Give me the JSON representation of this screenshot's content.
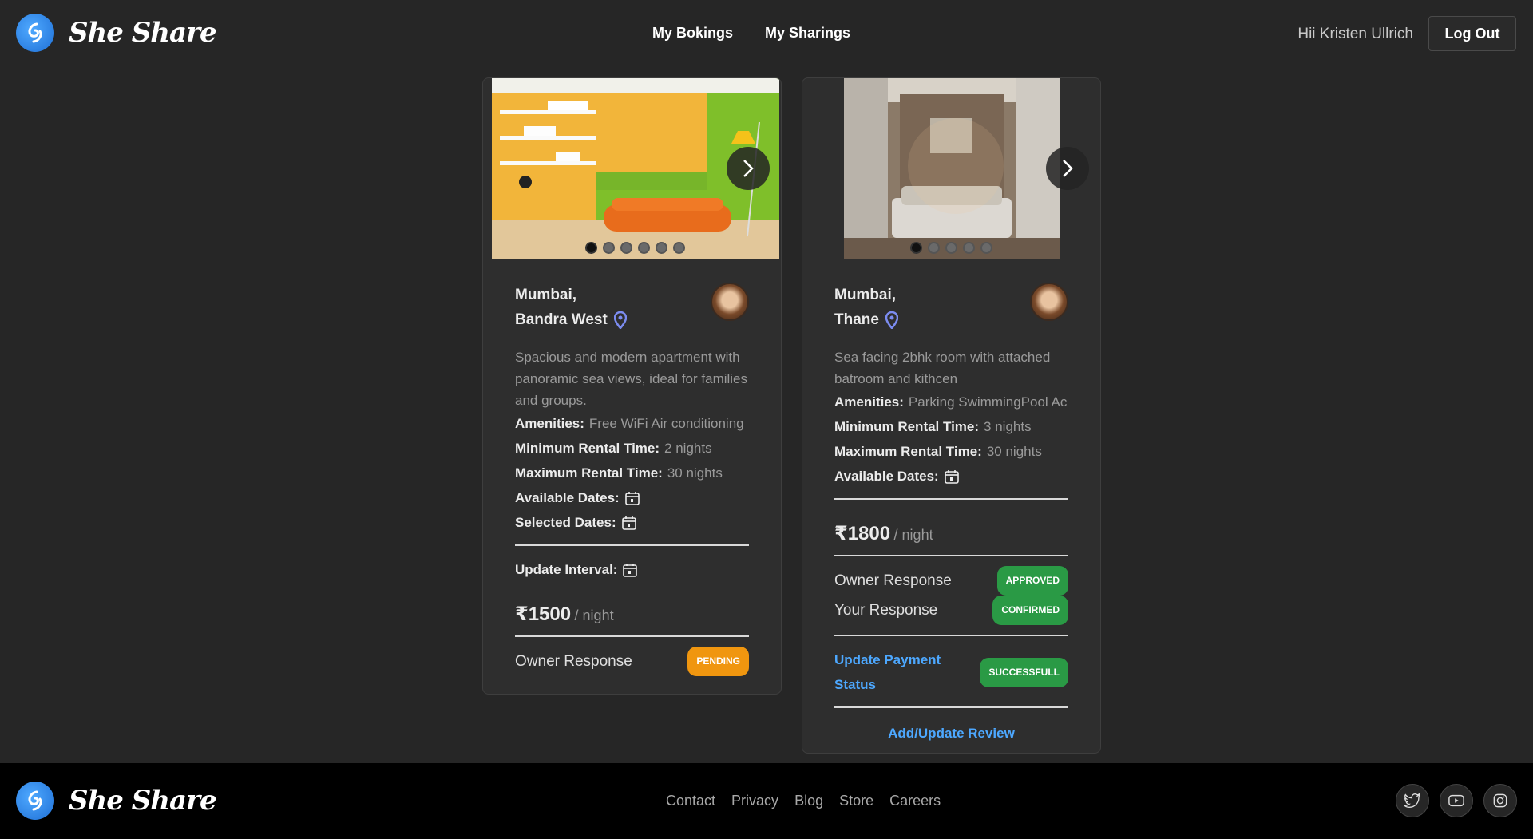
{
  "brand": {
    "name": "She Share",
    "logo_icon": "she-share-logo-icon",
    "accent": "#2f8df2"
  },
  "nav": {
    "bookings": "My Bokings",
    "sharings": "My Sharings"
  },
  "user": {
    "greeting": "Hii Kristen Ullrich",
    "logout": "Log Out"
  },
  "cards": [
    {
      "city": "Mumbai,",
      "area": "Bandra West",
      "description": "Spacious and modern apartment with panoramic sea views, ideal for families and groups.",
      "amenities_label": "Amenities:",
      "amenities": "Free WiFi Air conditioning",
      "min_label": "Minimum Rental Time:",
      "min_value": "2 nights",
      "max_label": "Maximum Rental Time:",
      "max_value": "30 nights",
      "available_label": "Available Dates:",
      "selected_label": "Selected Dates:",
      "interval_label": "Update Interval:",
      "price": "₹1500",
      "per": "/ night",
      "owner_response_label": "Owner Response",
      "owner_response": "PENDING",
      "image_count": 6,
      "active_image": 1
    },
    {
      "city": "Mumbai,",
      "area": "Thane",
      "description": "Sea facing 2bhk room with attached batroom and kithcen",
      "amenities_label": "Amenities:",
      "amenities": "Parking SwimmingPool Ac",
      "min_label": "Minimum Rental Time:",
      "min_value": "3 nights",
      "max_label": "Maximum Rental Time:",
      "max_value": "30 nights",
      "available_label": "Available Dates:",
      "price": "₹1800",
      "per": "/ night",
      "owner_response_label": "Owner Response",
      "owner_response": "APPROVED",
      "your_response_label": "Your Response",
      "your_response": "CONFIRMED",
      "payment_link": "Update Payment Status",
      "payment_status": "SUCCESSFULL",
      "review_link": "Add/Update Review",
      "image_count": 5,
      "active_image": 1
    }
  ],
  "footer": {
    "links": [
      "Contact",
      "Privacy",
      "Blog",
      "Store",
      "Careers"
    ],
    "socials": [
      "twitter-icon",
      "youtube-icon",
      "instagram-icon"
    ]
  },
  "colors": {
    "pending": "#f0960f",
    "success": "#2a9a45",
    "link": "#4da8ff",
    "pin": "#7c8cf0"
  }
}
